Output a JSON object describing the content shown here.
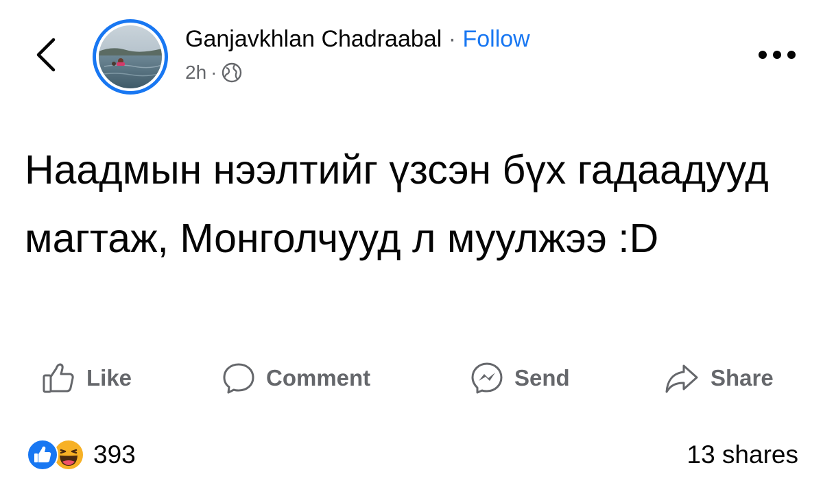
{
  "header": {
    "back_icon": "chevron-left-icon",
    "author_name": "Ganjavkhlan Chadraabal",
    "separator": "·",
    "follow_label": "Follow",
    "time_ago": "2h",
    "meta_separator": "·",
    "privacy_icon": "globe-icon",
    "more_icon": "ellipsis-icon"
  },
  "post": {
    "text": "Наадмын нээлтийг үзсэн бүх гадаадууд магтаж, Монголчууд л муулжээ :D"
  },
  "actions": [
    {
      "label": "Like",
      "icon": "thumbs-up-icon"
    },
    {
      "label": "Comment",
      "icon": "comment-bubble-icon"
    },
    {
      "label": "Send",
      "icon": "messenger-icon"
    },
    {
      "label": "Share",
      "icon": "share-arrow-icon"
    }
  ],
  "stats": {
    "reaction_icons": [
      "like-reaction-icon",
      "haha-reaction-icon"
    ],
    "reaction_count": "393",
    "shares_text": "13 shares"
  },
  "colors": {
    "accent": "#1877f2",
    "secondary_text": "#65676b",
    "primary_text": "#050505",
    "haha": "#f7b125"
  }
}
